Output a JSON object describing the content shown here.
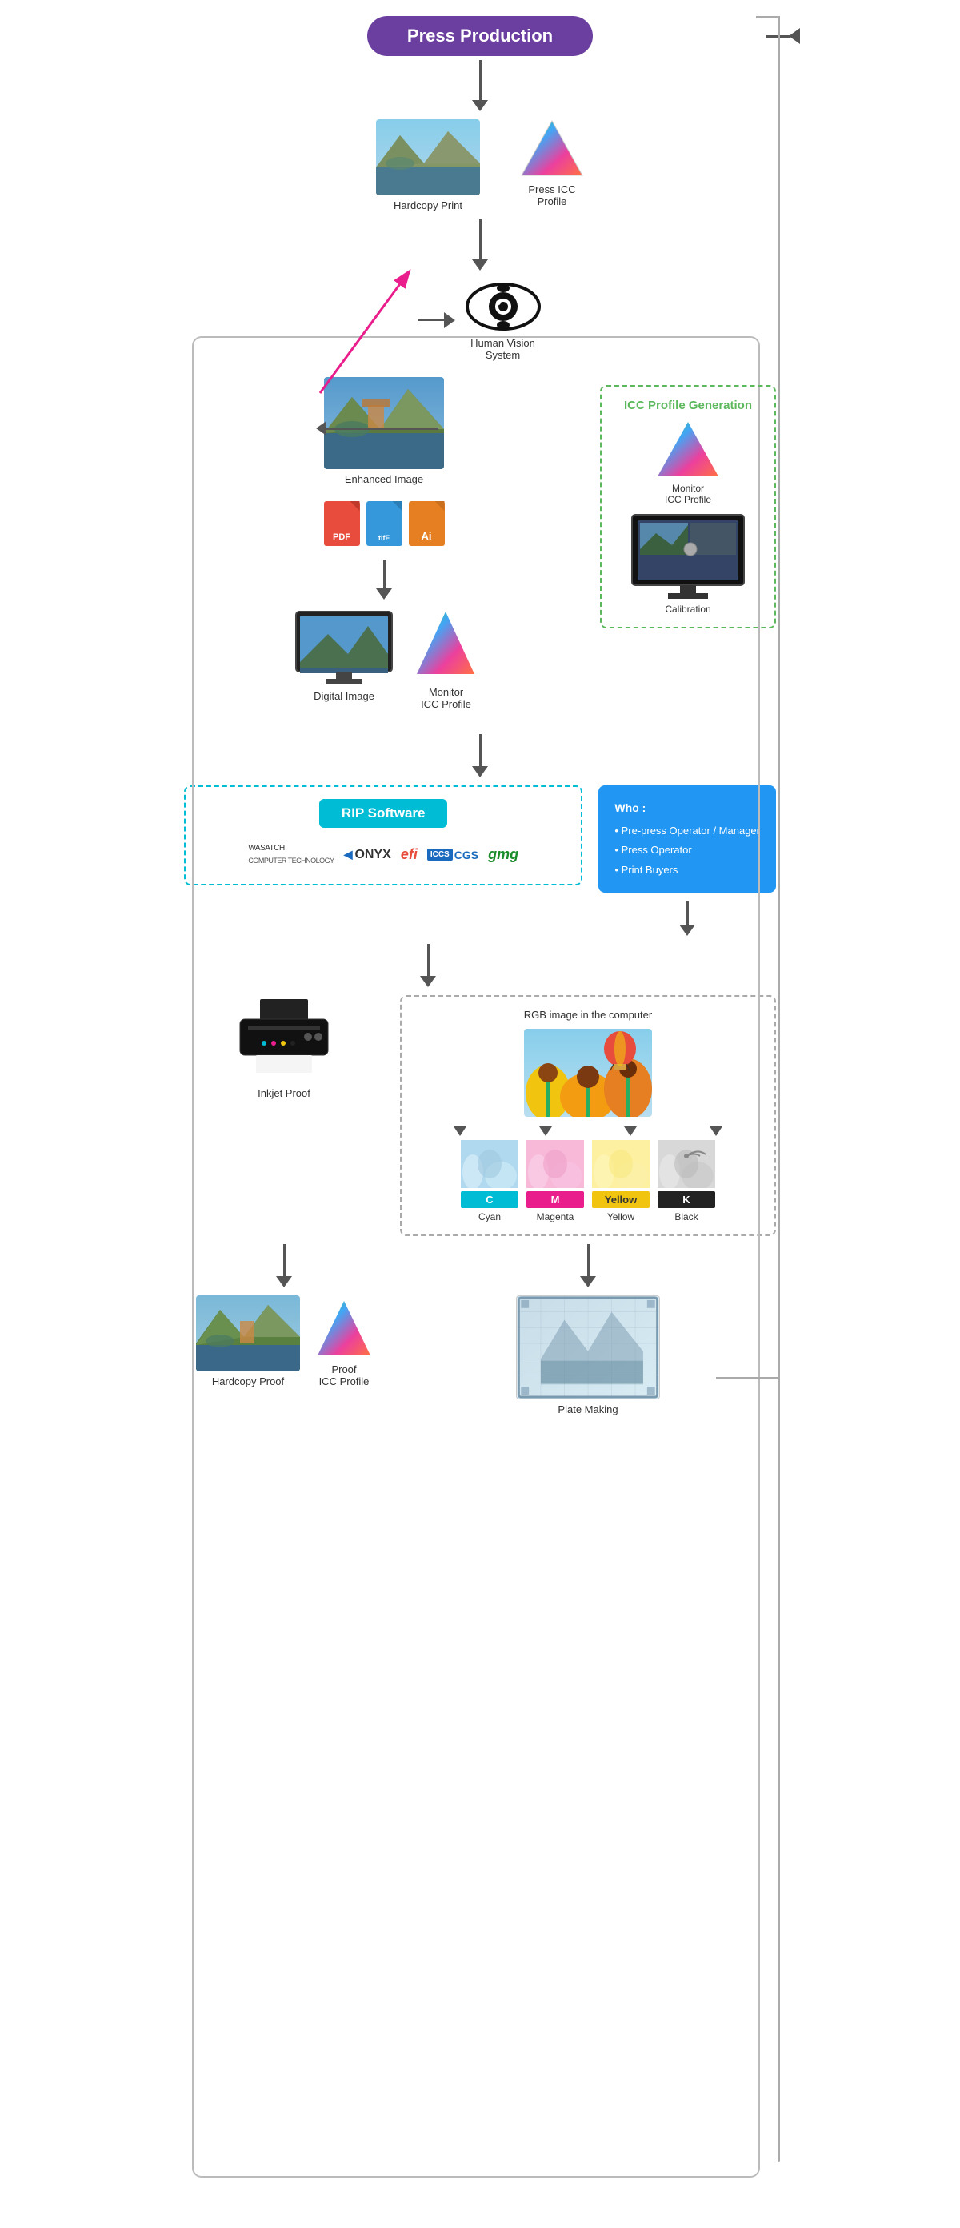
{
  "header": {
    "title": "Press Production",
    "title_bg": "#6b3fa0"
  },
  "sections": {
    "hardcopy_print": "Hardcopy Print",
    "press_icc_profile": "Press ICC\nProfile",
    "human_vision": "Human Vision\nSystem",
    "icc_generation": "ICC Profile Generation",
    "enhanced_image": "Enhanced Image",
    "monitor_icc_profile_1": "Monitor\nICC Profile",
    "calibration": "Calibration",
    "file_formats": [
      "PDF",
      "tIfF",
      "Ai"
    ],
    "digital_image": "Digital Image",
    "monitor_icc_profile_2": "Monitor\nICC Profile",
    "rip_software": "RIP Software",
    "brands": [
      "WASATCH",
      "ONYX",
      "efi",
      "CGS",
      "gmg"
    ],
    "who_title": "Who :",
    "who_items": [
      "Pre-press Operator / Manager",
      "Press Operator",
      "Print Buyers"
    ],
    "rgb_label": "RGB image in the computer",
    "inkjet_proof": "Inkjet Proof",
    "cmyk_channels": {
      "c_label": "C",
      "m_label": "M",
      "y_label": "Yellow",
      "k_label": "Black",
      "c_name": "Cyan",
      "m_name": "Magenta",
      "y_name": "Yellow",
      "k_name": "Black"
    },
    "plate_making": "Plate Making",
    "hardcopy_proof": "Hardcopy Proof",
    "proof_icc_profile": "Proof\nICC Profile"
  },
  "colors": {
    "purple": "#6b3fa0",
    "teal": "#00bcd4",
    "green_dashed": "#5cb85c",
    "blue_btn": "#2196f3",
    "arrow": "#555555",
    "pink": "#e91e8c"
  }
}
